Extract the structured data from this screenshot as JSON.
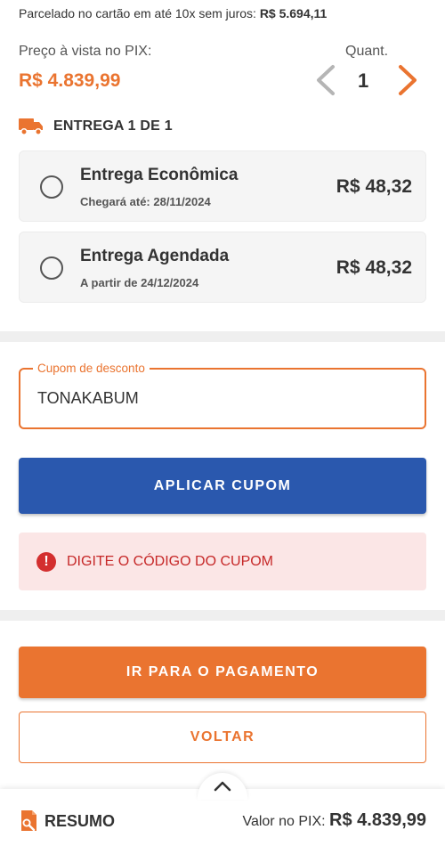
{
  "installments": {
    "text": "Parcelado no cartão em até 10x sem juros:",
    "amount": "R$ 5.694,11"
  },
  "pix": {
    "label": "Preço à vista no PIX:",
    "price": "R$ 4.839,99"
  },
  "quantity": {
    "label": "Quant.",
    "value": "1"
  },
  "delivery": {
    "title": "ENTREGA 1 DE 1",
    "options": [
      {
        "name": "Entrega Econômica",
        "date": "Chegará até: 28/11/2024",
        "price": "R$ 48,32"
      },
      {
        "name": "Entrega Agendada",
        "date": "A partir de 24/12/2024",
        "price": "R$ 48,32"
      }
    ]
  },
  "coupon": {
    "legend": "Cupom de desconto",
    "value": "TONAKABUM",
    "apply_label": "APLICAR CUPOM"
  },
  "error": {
    "icon": "!",
    "message": "DIGITE O CÓDIGO DO CUPOM"
  },
  "actions": {
    "pay_label": "IR PARA O PAGAMENTO",
    "back_label": "VOLTAR"
  },
  "footer": {
    "summary_label": "RESUMO",
    "total_label": "Valor no PIX:",
    "total_value": "R$ 4.839,99"
  },
  "colors": {
    "accent": "#ea7430",
    "primary": "#2a58ae",
    "error": "#c62828",
    "error_bg": "#fbe6e6"
  },
  "icons": [
    "truck-icon",
    "chevron-left-icon",
    "chevron-right-icon",
    "radio-icon",
    "error-icon",
    "chevron-up-icon",
    "receipt-search-icon"
  ]
}
